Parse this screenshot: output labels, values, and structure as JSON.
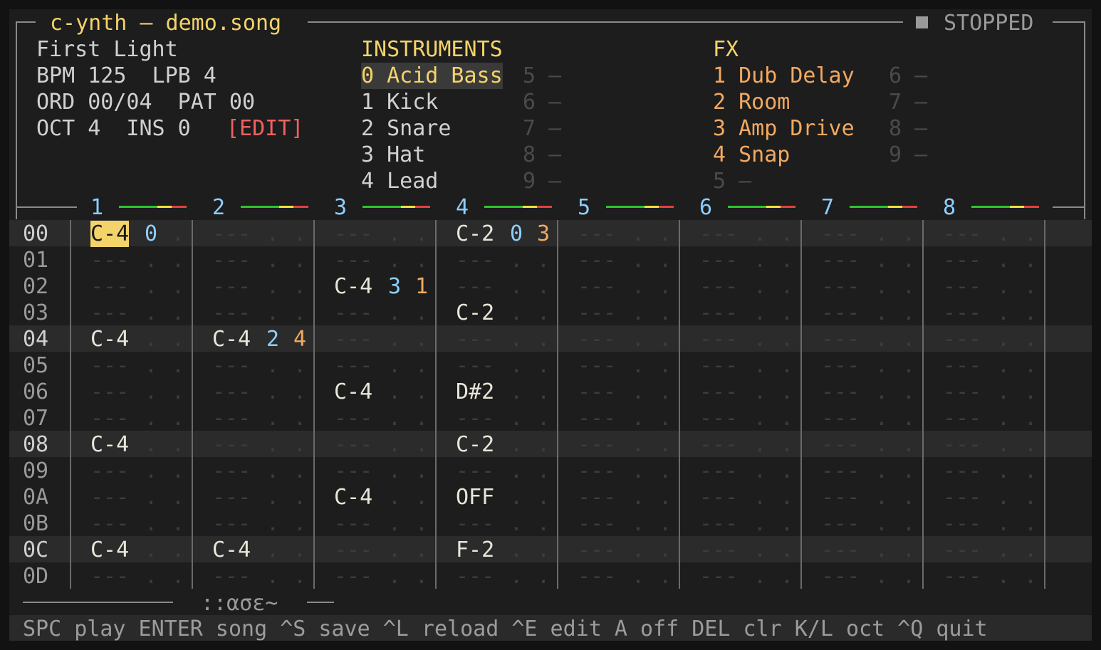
{
  "app": {
    "title": "c-ynth — demo.song",
    "status_icon": "stop-square-icon",
    "status": "STOPPED"
  },
  "song": {
    "name": "First Light",
    "bpm_line": "BPM 125  LPB 4",
    "ord_line": "ORD 00/04  PAT 00",
    "oct_line": "OCT 4  INS 0",
    "mode": "[EDIT]"
  },
  "instruments": {
    "header": "INSTRUMENTS",
    "left": [
      "0 Acid Bass",
      "1 Kick",
      "2 Snare",
      "3 Hat",
      "4 Lead"
    ],
    "right": [
      "5 —",
      "6 —",
      "7 —",
      "8 —",
      "9 —"
    ],
    "selected_index": 0
  },
  "fx": {
    "header": "FX",
    "left": [
      "1 Dub Delay",
      "2 Room",
      "3 Amp Drive",
      "4 Snap",
      "5 —"
    ],
    "right": [
      "6 —",
      "7 —",
      "8 —",
      "9 —"
    ]
  },
  "channels": [
    "1",
    "2",
    "3",
    "4",
    "5",
    "6",
    "7",
    "8"
  ],
  "meter_colors": {
    "low": "#2ec42e",
    "mid": "#f0e040",
    "high": "#e04040"
  },
  "rows": [
    {
      "idx": "00",
      "hl": true,
      "cells": [
        [
          "C-4",
          "0",
          ""
        ],
        [
          "",
          "",
          ""
        ],
        [
          "",
          "",
          ""
        ],
        [
          "C-2",
          "0",
          "3"
        ],
        [
          "",
          "",
          ""
        ],
        [
          "",
          "",
          ""
        ],
        [
          "",
          "",
          ""
        ],
        [
          "",
          "",
          ""
        ]
      ]
    },
    {
      "idx": "01",
      "hl": false,
      "cells": [
        [
          "",
          "",
          ""
        ],
        [
          "",
          "",
          ""
        ],
        [
          "",
          "",
          ""
        ],
        [
          "",
          "",
          ""
        ],
        [
          "",
          "",
          ""
        ],
        [
          "",
          "",
          ""
        ],
        [
          "",
          "",
          ""
        ],
        [
          "",
          "",
          ""
        ]
      ]
    },
    {
      "idx": "02",
      "hl": false,
      "cells": [
        [
          "",
          "",
          ""
        ],
        [
          "",
          "",
          ""
        ],
        [
          "C-4",
          "3",
          "1"
        ],
        [
          "",
          "",
          ""
        ],
        [
          "",
          "",
          ""
        ],
        [
          "",
          "",
          ""
        ],
        [
          "",
          "",
          ""
        ],
        [
          "",
          "",
          ""
        ]
      ]
    },
    {
      "idx": "03",
      "hl": false,
      "cells": [
        [
          "",
          "",
          ""
        ],
        [
          "",
          "",
          ""
        ],
        [
          "",
          "",
          ""
        ],
        [
          "C-2",
          "",
          ""
        ],
        [
          "",
          "",
          ""
        ],
        [
          "",
          "",
          ""
        ],
        [
          "",
          "",
          ""
        ],
        [
          "",
          "",
          ""
        ]
      ]
    },
    {
      "idx": "04",
      "hl": true,
      "cells": [
        [
          "C-4",
          "",
          ""
        ],
        [
          "C-4",
          "2",
          "4"
        ],
        [
          "",
          "",
          ""
        ],
        [
          "",
          "",
          ""
        ],
        [
          "",
          "",
          ""
        ],
        [
          "",
          "",
          ""
        ],
        [
          "",
          "",
          ""
        ],
        [
          "",
          "",
          ""
        ]
      ]
    },
    {
      "idx": "05",
      "hl": false,
      "cells": [
        [
          "",
          "",
          ""
        ],
        [
          "",
          "",
          ""
        ],
        [
          "",
          "",
          ""
        ],
        [
          "",
          "",
          ""
        ],
        [
          "",
          "",
          ""
        ],
        [
          "",
          "",
          ""
        ],
        [
          "",
          "",
          ""
        ],
        [
          "",
          "",
          ""
        ]
      ]
    },
    {
      "idx": "06",
      "hl": false,
      "cells": [
        [
          "",
          "",
          ""
        ],
        [
          "",
          "",
          ""
        ],
        [
          "C-4",
          "",
          ""
        ],
        [
          "D#2",
          "",
          ""
        ],
        [
          "",
          "",
          ""
        ],
        [
          "",
          "",
          ""
        ],
        [
          "",
          "",
          ""
        ],
        [
          "",
          "",
          ""
        ]
      ]
    },
    {
      "idx": "07",
      "hl": false,
      "cells": [
        [
          "",
          "",
          ""
        ],
        [
          "",
          "",
          ""
        ],
        [
          "",
          "",
          ""
        ],
        [
          "",
          "",
          ""
        ],
        [
          "",
          "",
          ""
        ],
        [
          "",
          "",
          ""
        ],
        [
          "",
          "",
          ""
        ],
        [
          "",
          "",
          ""
        ]
      ]
    },
    {
      "idx": "08",
      "hl": true,
      "cells": [
        [
          "C-4",
          "",
          ""
        ],
        [
          "",
          "",
          ""
        ],
        [
          "",
          "",
          ""
        ],
        [
          "C-2",
          "",
          ""
        ],
        [
          "",
          "",
          ""
        ],
        [
          "",
          "",
          ""
        ],
        [
          "",
          "",
          ""
        ],
        [
          "",
          "",
          ""
        ]
      ]
    },
    {
      "idx": "09",
      "hl": false,
      "cells": [
        [
          "",
          "",
          ""
        ],
        [
          "",
          "",
          ""
        ],
        [
          "",
          "",
          ""
        ],
        [
          "",
          "",
          ""
        ],
        [
          "",
          "",
          ""
        ],
        [
          "",
          "",
          ""
        ],
        [
          "",
          "",
          ""
        ],
        [
          "",
          "",
          ""
        ]
      ]
    },
    {
      "idx": "0A",
      "hl": false,
      "cells": [
        [
          "",
          "",
          ""
        ],
        [
          "",
          "",
          ""
        ],
        [
          "C-4",
          "",
          ""
        ],
        [
          "OFF",
          "",
          ""
        ],
        [
          "",
          "",
          ""
        ],
        [
          "",
          "",
          ""
        ],
        [
          "",
          "",
          ""
        ],
        [
          "",
          "",
          ""
        ]
      ]
    },
    {
      "idx": "0B",
      "hl": false,
      "cells": [
        [
          "",
          "",
          ""
        ],
        [
          "",
          "",
          ""
        ],
        [
          "",
          "",
          ""
        ],
        [
          "",
          "",
          ""
        ],
        [
          "",
          "",
          ""
        ],
        [
          "",
          "",
          ""
        ],
        [
          "",
          "",
          ""
        ],
        [
          "",
          "",
          ""
        ]
      ]
    },
    {
      "idx": "0C",
      "hl": true,
      "cells": [
        [
          "C-4",
          "",
          ""
        ],
        [
          "C-4",
          "",
          ""
        ],
        [
          "",
          "",
          ""
        ],
        [
          "F-2",
          "",
          ""
        ],
        [
          "",
          "",
          ""
        ],
        [
          "",
          "",
          ""
        ],
        [
          "",
          "",
          ""
        ],
        [
          "",
          "",
          ""
        ]
      ]
    },
    {
      "idx": "0D",
      "hl": false,
      "cells": [
        [
          "",
          "",
          ""
        ],
        [
          "",
          "",
          ""
        ],
        [
          "",
          "",
          ""
        ],
        [
          "",
          "",
          ""
        ],
        [
          "",
          "",
          ""
        ],
        [
          "",
          "",
          ""
        ],
        [
          "",
          "",
          ""
        ],
        [
          "",
          "",
          ""
        ]
      ]
    }
  ],
  "empty_note": "---",
  "empty_param": ".",
  "scope": {
    "label": "::ασε~"
  },
  "help": "SPC play ENTER song ^S save ^L reload ^E edit A off DEL clr K/L oct ^Q quit"
}
